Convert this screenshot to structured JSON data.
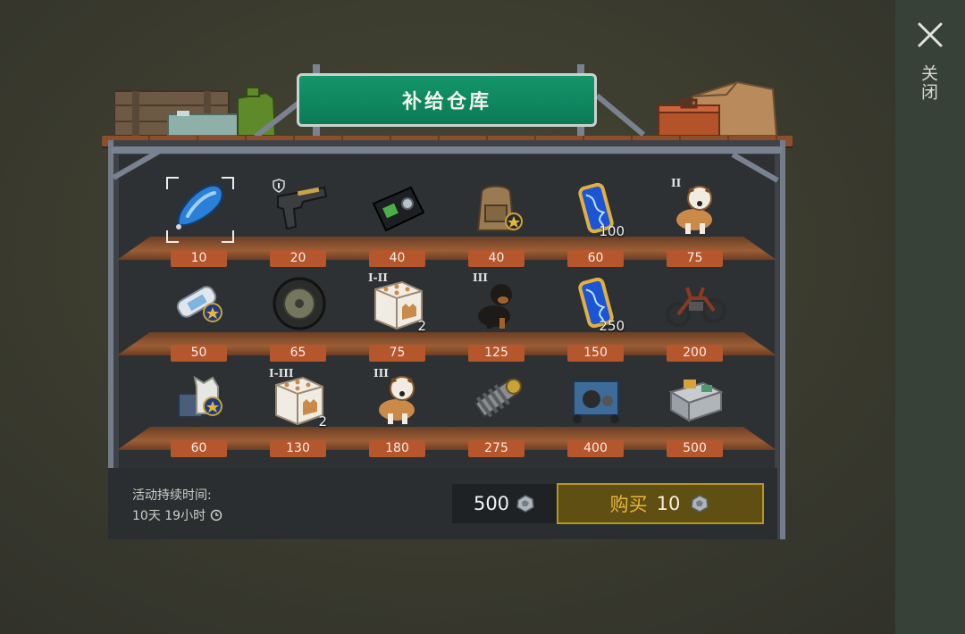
{
  "header": {
    "title": "补给仓库"
  },
  "close": {
    "label": "关闭"
  },
  "grid": {
    "rows": [
      [
        {
          "price": "10",
          "qty": "",
          "tier": "",
          "icon": "blue-capsule-icon"
        },
        {
          "price": "20",
          "qty": "",
          "tier": "",
          "icon": "pistol-icon"
        },
        {
          "price": "40",
          "qty": "",
          "tier": "",
          "icon": "id-wallet-icon"
        },
        {
          "price": "40",
          "qty": "",
          "tier": "",
          "icon": "backpack-icon"
        },
        {
          "price": "60",
          "qty": "100",
          "tier": "",
          "icon": "dna-vial-icon"
        },
        {
          "price": "75",
          "qty": "",
          "tier": "II",
          "icon": "saint-bernard-dog-icon"
        }
      ],
      [
        {
          "price": "50",
          "qty": "",
          "tier": "",
          "icon": "blueprint-scroll-icon"
        },
        {
          "price": "65",
          "qty": "",
          "tier": "",
          "icon": "wheel-icon"
        },
        {
          "price": "75",
          "qty": "2",
          "tier": "I-II",
          "icon": "supply-crate-icon"
        },
        {
          "price": "125",
          "qty": "",
          "tier": "III",
          "icon": "rottweiler-dog-icon"
        },
        {
          "price": "150",
          "qty": "250",
          "tier": "",
          "icon": "dna-vial-icon"
        },
        {
          "price": "200",
          "qty": "",
          "tier": "",
          "icon": "motorcycle-icon"
        }
      ],
      [
        {
          "price": "60",
          "qty": "",
          "tier": "",
          "icon": "vest-blueprint-icon"
        },
        {
          "price": "130",
          "qty": "2",
          "tier": "I-III",
          "icon": "supply-crate-icon"
        },
        {
          "price": "180",
          "qty": "",
          "tier": "III",
          "icon": "saint-bernard-dog-icon"
        },
        {
          "price": "275",
          "qty": "",
          "tier": "",
          "icon": "engine-part-icon"
        },
        {
          "price": "400",
          "qty": "",
          "tier": "",
          "icon": "generator-icon"
        },
        {
          "price": "500",
          "qty": "",
          "tier": "",
          "icon": "workbench-icon"
        }
      ]
    ]
  },
  "footer": {
    "duration_label": "活动持续时间:",
    "duration_value": "10天 19小时",
    "balance": "500",
    "buy_label": "购买",
    "buy_cost": "10",
    "currency_icon": "ore-chip-icon"
  },
  "colors": {
    "sign": "#0f8a61",
    "price_tag": "#b5562c",
    "buy_border": "#b8961f",
    "buy_text": "#e6b83a"
  }
}
